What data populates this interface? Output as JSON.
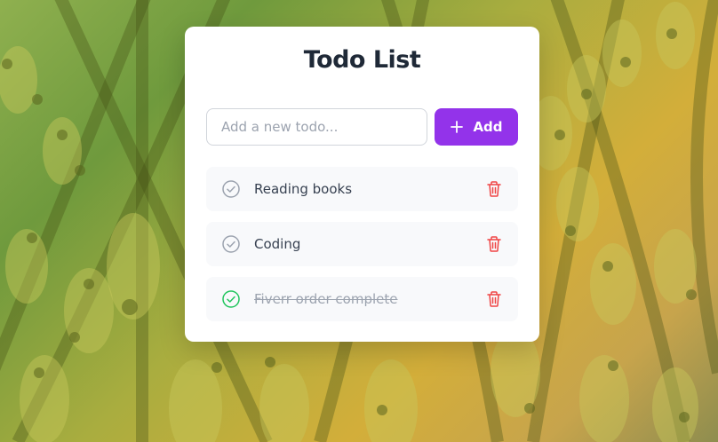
{
  "app": {
    "title": "Todo List"
  },
  "new_todo": {
    "placeholder": "Add a new todo...",
    "value": "",
    "add_label": "Add",
    "add_icon": "plus-icon"
  },
  "todos": [
    {
      "text": "Reading books",
      "completed": false,
      "check_icon": "check-circle-icon",
      "delete_icon": "trash-icon"
    },
    {
      "text": "Coding",
      "completed": false,
      "check_icon": "check-circle-icon",
      "delete_icon": "trash-icon"
    },
    {
      "text": "Fiverr order complete",
      "completed": true,
      "check_icon": "check-circle-icon",
      "delete_icon": "trash-icon"
    }
  ],
  "colors": {
    "accent": "#9333ea",
    "completed_check": "#22c55e",
    "pending_check": "#9ca3af",
    "delete": "#ef4444",
    "title_text": "#1f2937"
  }
}
